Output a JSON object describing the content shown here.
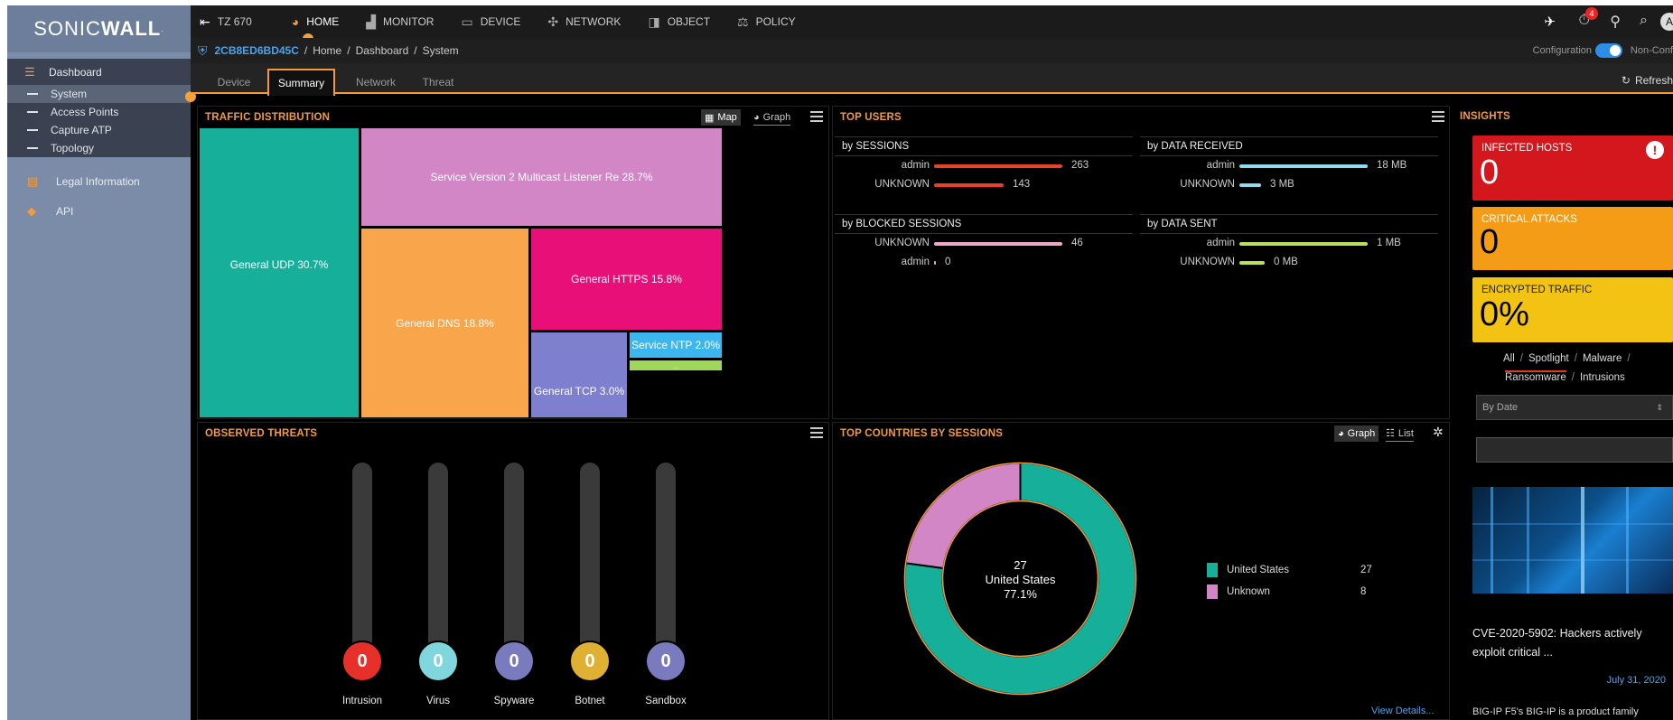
{
  "brand": {
    "logo_pre": "SONIC",
    "logo_bold": "WALL"
  },
  "sidebar": {
    "dashboard": "Dashboard",
    "items": [
      "System",
      "Access Points",
      "Capture ATP",
      "Topology"
    ],
    "legal": "Legal Information",
    "api": "API"
  },
  "topnav": {
    "device_model": "TZ 670",
    "items": [
      "HOME",
      "MONITOR",
      "DEVICE",
      "NETWORK",
      "OBJECT",
      "POLICY"
    ],
    "alert_count": "4"
  },
  "breadcrumb": {
    "serial": "2CB8ED6BD45C",
    "path": [
      "Home",
      "Dashboard",
      "System"
    ],
    "mode_label": "Configuration",
    "mode_other": "Non-Conf",
    "refresh": "Refresh"
  },
  "tabs": [
    "Device",
    "Summary",
    "Network",
    "Threat"
  ],
  "traffic": {
    "title": "TRAFFIC DISTRIBUTION",
    "view_map": "Map",
    "view_graph": "Graph",
    "more": "...",
    "cells": [
      {
        "label": "General UDP 30.7%",
        "value": 30.7,
        "color": "#16b09a"
      },
      {
        "label": "Service Version 2 Multicast Listener Re 28.7%",
        "value": 28.7,
        "color": "#d286c6"
      },
      {
        "label": "General DNS 18.8%",
        "value": 18.8,
        "color": "#f9a54b"
      },
      {
        "label": "General HTTPS 15.8%",
        "value": 15.8,
        "color": "#e90f78"
      },
      {
        "label": "General TCP 3.0%",
        "value": 3.0,
        "color": "#7f7fd0"
      },
      {
        "label": "Service NTP 2.0%",
        "value": 2.0,
        "color": "#3cb6ef"
      }
    ],
    "other_color": "#9ed75a"
  },
  "top_users": {
    "title": "TOP USERS",
    "sections": [
      {
        "title": "by SESSIONS",
        "rows": [
          {
            "name": "admin",
            "value": "263",
            "level": 1.0,
            "color": "#e8402a"
          },
          {
            "name": "UNKNOWN",
            "value": "143",
            "level": 0.54,
            "color": "#e8402a"
          }
        ]
      },
      {
        "title": "by DATA RECEIVED",
        "rows": [
          {
            "name": "admin",
            "value": "18 MB",
            "level": 1.0,
            "color": "#8edcf0"
          },
          {
            "name": "UNKNOWN",
            "value": "3 MB",
            "level": 0.17,
            "color": "#8edcf0"
          }
        ]
      },
      {
        "title": "by BLOCKED SESSIONS",
        "rows": [
          {
            "name": "UNKNOWN",
            "value": "46",
            "level": 1.0,
            "color": "#f0a6c8"
          },
          {
            "name": "admin",
            "value": "0",
            "level": 0.0,
            "color": "#f0a6c8"
          }
        ]
      },
      {
        "title": "by DATA SENT",
        "rows": [
          {
            "name": "admin",
            "value": "1 MB",
            "level": 1.0,
            "color": "#b8e05c"
          },
          {
            "name": "UNKNOWN",
            "value": "0 MB",
            "level": 0.2,
            "color": "#b8e05c"
          }
        ]
      }
    ]
  },
  "threats": {
    "title": "OBSERVED THREATS",
    "items": [
      {
        "label": "Intrusion",
        "value": "0",
        "color": "#e8302a"
      },
      {
        "label": "Virus",
        "value": "0",
        "color": "#7fd6dc"
      },
      {
        "label": "Spyware",
        "value": "0",
        "color": "#7a7abf"
      },
      {
        "label": "Botnet",
        "value": "0",
        "color": "#e0b033"
      },
      {
        "label": "Sandbox",
        "value": "0",
        "color": "#7a7abf"
      }
    ]
  },
  "countries": {
    "title": "TOP COUNTRIES BY SESSIONS",
    "view_graph": "Graph",
    "view_list": "List",
    "center_value": "27",
    "center_name": "United States",
    "center_pct": "77.1%",
    "view_details": "View Details...",
    "legend": [
      {
        "name": "United States",
        "value": "27",
        "color": "#16b09a"
      },
      {
        "name": "Unknown",
        "value": "8",
        "color": "#d286c6"
      }
    ]
  },
  "chart_data": {
    "type": "pie",
    "categories": [
      "United States",
      "Unknown"
    ],
    "values": [
      27,
      8
    ]
  },
  "insights": {
    "title": "INSIGHTS",
    "cards": [
      {
        "title": "INFECTED HOSTS",
        "value": "0",
        "color": "#d3171d"
      },
      {
        "title": "CRITICAL ATTACKS",
        "value": "0",
        "color": "#f59c16"
      },
      {
        "title": "ENCRYPTED TRAFFIC",
        "value": "0%",
        "color": "#f2c313"
      }
    ],
    "filters_line1": [
      "All",
      "Spotlight",
      "Malware"
    ],
    "filters_line2": [
      "Ransomware",
      "Intrusions"
    ],
    "sort_select": "By Date",
    "news_title": "CVE-2020-5902: Hackers actively exploit critical ...",
    "news_date": "July 31, 2020",
    "news_body": "BIG-IP F5's BIG-IP is a product family"
  }
}
